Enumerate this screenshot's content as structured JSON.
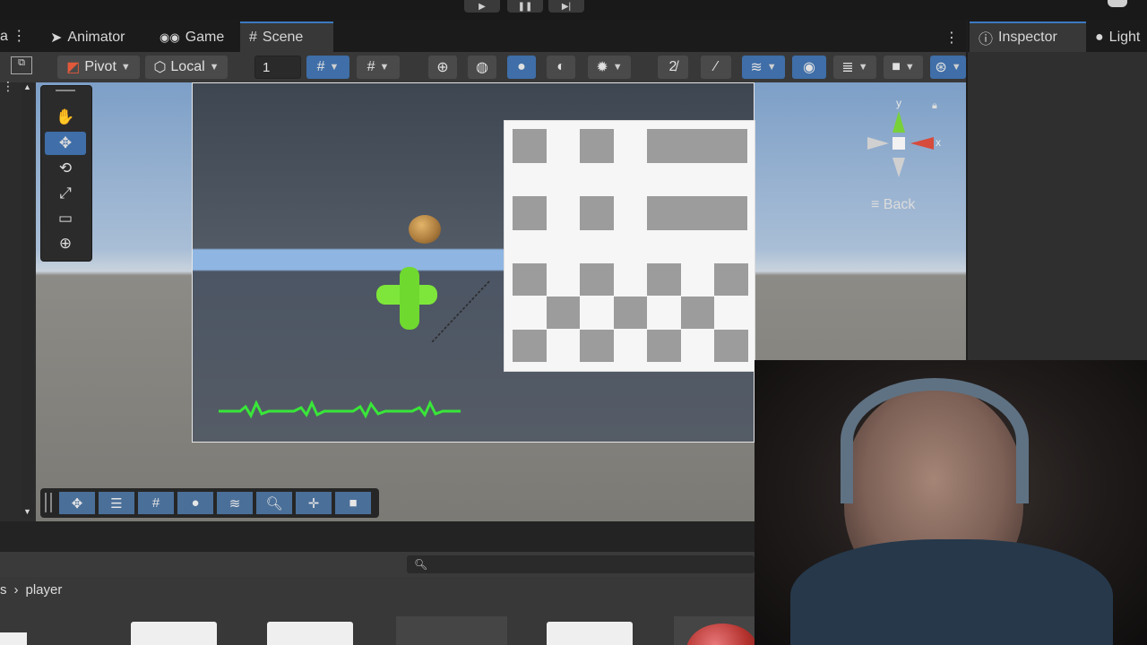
{
  "tabs": {
    "animator": "Animator",
    "game": "Game",
    "scene": "Scene",
    "inspector": "Inspector",
    "lighting": "Light"
  },
  "toolbar": {
    "pivot": "Pivot",
    "local": "Local",
    "grid_value": "1"
  },
  "gizmo": {
    "y_axis": "y",
    "x_axis": "x",
    "view_label": "Back"
  },
  "project": {
    "breadcrumb_prefix": "s",
    "breadcrumb_folder": "player"
  },
  "icons": [
    "hand-icon",
    "move-icon",
    "rotate-icon",
    "scale-icon",
    "rect-icon",
    "transform-icon",
    "play-icon",
    "pause-icon",
    "step-icon",
    "search-icon",
    "lock-icon",
    "info-icon",
    "lightbulb-icon"
  ],
  "colors": {
    "accent": "#3f6ea8",
    "selected_tab_border": "#3d79c2",
    "player_green": "#7ee63a",
    "heartbeat": "#39e639"
  }
}
